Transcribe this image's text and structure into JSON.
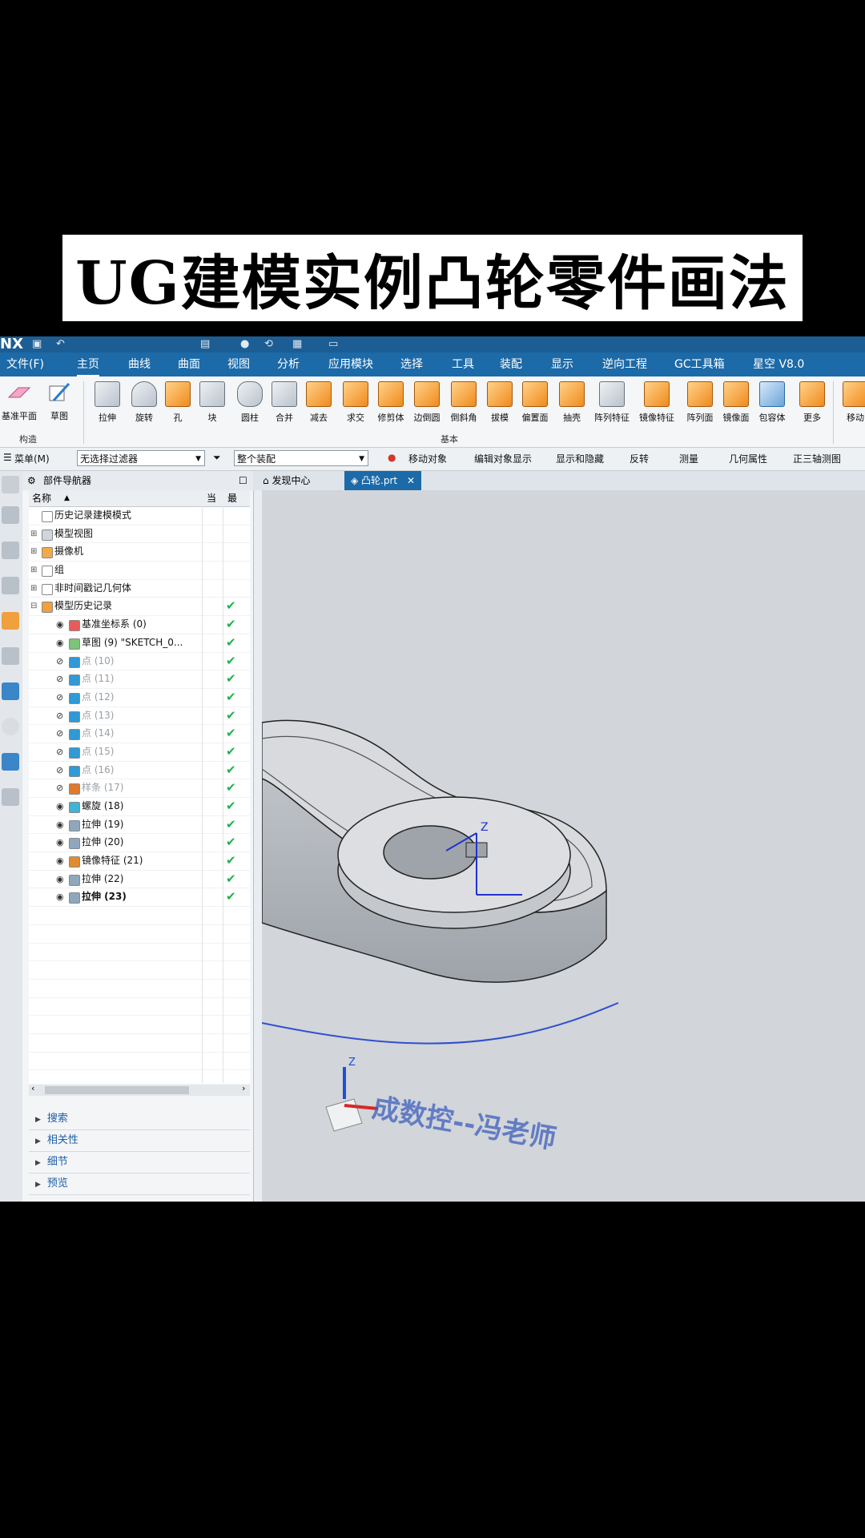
{
  "title": "UG建模实例凸轮零件画法",
  "app": {
    "logo": "NX",
    "menu": [
      {
        "label": "文件(F)",
        "active": false
      },
      {
        "label": "主页",
        "active": true
      },
      {
        "label": "曲线",
        "active": false
      },
      {
        "label": "曲面",
        "active": false
      },
      {
        "label": "视图",
        "active": false
      },
      {
        "label": "分析",
        "active": false
      },
      {
        "label": "应用模块",
        "active": false
      },
      {
        "label": "选择",
        "active": false
      },
      {
        "label": "工具",
        "active": false
      },
      {
        "label": "装配",
        "active": false
      },
      {
        "label": "显示",
        "active": false
      },
      {
        "label": "逆向工程",
        "active": false
      },
      {
        "label": "GC工具箱",
        "active": false
      },
      {
        "label": "星空 V8.0",
        "active": false
      }
    ],
    "ribbon": {
      "groups": {
        "construct": "构造",
        "basic": "基本"
      },
      "buttons": [
        {
          "label": "基准平面",
          "icon": "datum-plane-icon"
        },
        {
          "label": "草图",
          "icon": "sketch-icon"
        },
        {
          "label": "拉伸",
          "icon": "extrude-icon"
        },
        {
          "label": "旋转",
          "icon": "revolve-icon"
        },
        {
          "label": "孔",
          "icon": "hole-icon"
        },
        {
          "label": "块",
          "icon": "block-icon"
        },
        {
          "label": "圆柱",
          "icon": "cylinder-icon"
        },
        {
          "label": "合并",
          "icon": "unite-icon"
        },
        {
          "label": "减去",
          "icon": "subtract-icon"
        },
        {
          "label": "求交",
          "icon": "intersect-icon"
        },
        {
          "label": "修剪体",
          "icon": "trim-body-icon"
        },
        {
          "label": "边倒圆",
          "icon": "edge-blend-icon"
        },
        {
          "label": "倒斜角",
          "icon": "chamfer-icon"
        },
        {
          "label": "拔模",
          "icon": "draft-icon"
        },
        {
          "label": "偏置面",
          "icon": "offset-face-icon"
        },
        {
          "label": "抽壳",
          "icon": "shell-icon"
        },
        {
          "label": "阵列特征",
          "icon": "pattern-feature-icon"
        },
        {
          "label": "镜像特征",
          "icon": "mirror-feature-icon"
        },
        {
          "label": "阵列面",
          "icon": "pattern-face-icon"
        },
        {
          "label": "镜像面",
          "icon": "mirror-face-icon"
        },
        {
          "label": "包容体",
          "icon": "bounding-body-icon"
        },
        {
          "label": "更多",
          "icon": "more-icon"
        },
        {
          "label": "移动",
          "icon": "move-icon"
        }
      ]
    },
    "filterbar": {
      "menu": "菜单(M)",
      "selection_filter": "无选择过滤器",
      "scope": "整个装配",
      "actions": [
        "移动对象",
        "编辑对象显示",
        "显示和隐藏",
        "反转",
        "测量",
        "几何属性",
        "正三轴测图"
      ]
    },
    "navigator": {
      "title": "部件导航器",
      "columns": {
        "name": "名称",
        "current": "当",
        "latest": "最"
      },
      "rows": [
        {
          "label": "历史记录建模模式",
          "indent": 0,
          "expander": "",
          "check": ""
        },
        {
          "label": "模型视图",
          "indent": 0,
          "expander": "+",
          "check": ""
        },
        {
          "label": "摄像机",
          "indent": 0,
          "expander": "+",
          "check": ""
        },
        {
          "label": "组",
          "indent": 0,
          "expander": "+",
          "check": ""
        },
        {
          "label": "非时间戳记几何体",
          "indent": 0,
          "expander": "+",
          "check": ""
        },
        {
          "label": "模型历史记录",
          "indent": 0,
          "expander": "−",
          "check": "✔"
        },
        {
          "label": "基准坐标系 (0)",
          "indent": 1,
          "expander": "",
          "check": "✔"
        },
        {
          "label": "草图 (9) \"SKETCH_0...",
          "indent": 1,
          "expander": "",
          "check": "✔"
        },
        {
          "label": "点 (10)",
          "indent": 1,
          "expander": "",
          "check": "✔"
        },
        {
          "label": "点 (11)",
          "indent": 1,
          "expander": "",
          "check": "✔"
        },
        {
          "label": "点 (12)",
          "indent": 1,
          "expander": "",
          "check": "✔"
        },
        {
          "label": "点 (13)",
          "indent": 1,
          "expander": "",
          "check": "✔"
        },
        {
          "label": "点 (14)",
          "indent": 1,
          "expander": "",
          "check": "✔"
        },
        {
          "label": "点 (15)",
          "indent": 1,
          "expander": "",
          "check": "✔"
        },
        {
          "label": "点 (16)",
          "indent": 1,
          "expander": "",
          "check": "✔"
        },
        {
          "label": "样条 (17)",
          "indent": 1,
          "expander": "",
          "check": "✔"
        },
        {
          "label": "螺旋 (18)",
          "indent": 1,
          "expander": "",
          "check": "✔"
        },
        {
          "label": "拉伸 (19)",
          "indent": 1,
          "expander": "",
          "check": "✔"
        },
        {
          "label": "拉伸 (20)",
          "indent": 1,
          "expander": "",
          "check": "✔"
        },
        {
          "label": "镜像特征 (21)",
          "indent": 1,
          "expander": "",
          "check": "✔"
        },
        {
          "label": "拉伸 (22)",
          "indent": 1,
          "expander": "",
          "check": "✔"
        },
        {
          "label": "拉伸 (23)",
          "indent": 1,
          "expander": "",
          "check": "✔"
        }
      ],
      "sections": [
        "搜索",
        "相关性",
        "细节",
        "预览"
      ]
    },
    "tabs": [
      {
        "label": "发现中心",
        "active": false
      },
      {
        "label": "凸轮.prt",
        "active": true
      }
    ],
    "viewport": {
      "axis_label": "Z",
      "watermark": "成数控--冯老师"
    }
  }
}
